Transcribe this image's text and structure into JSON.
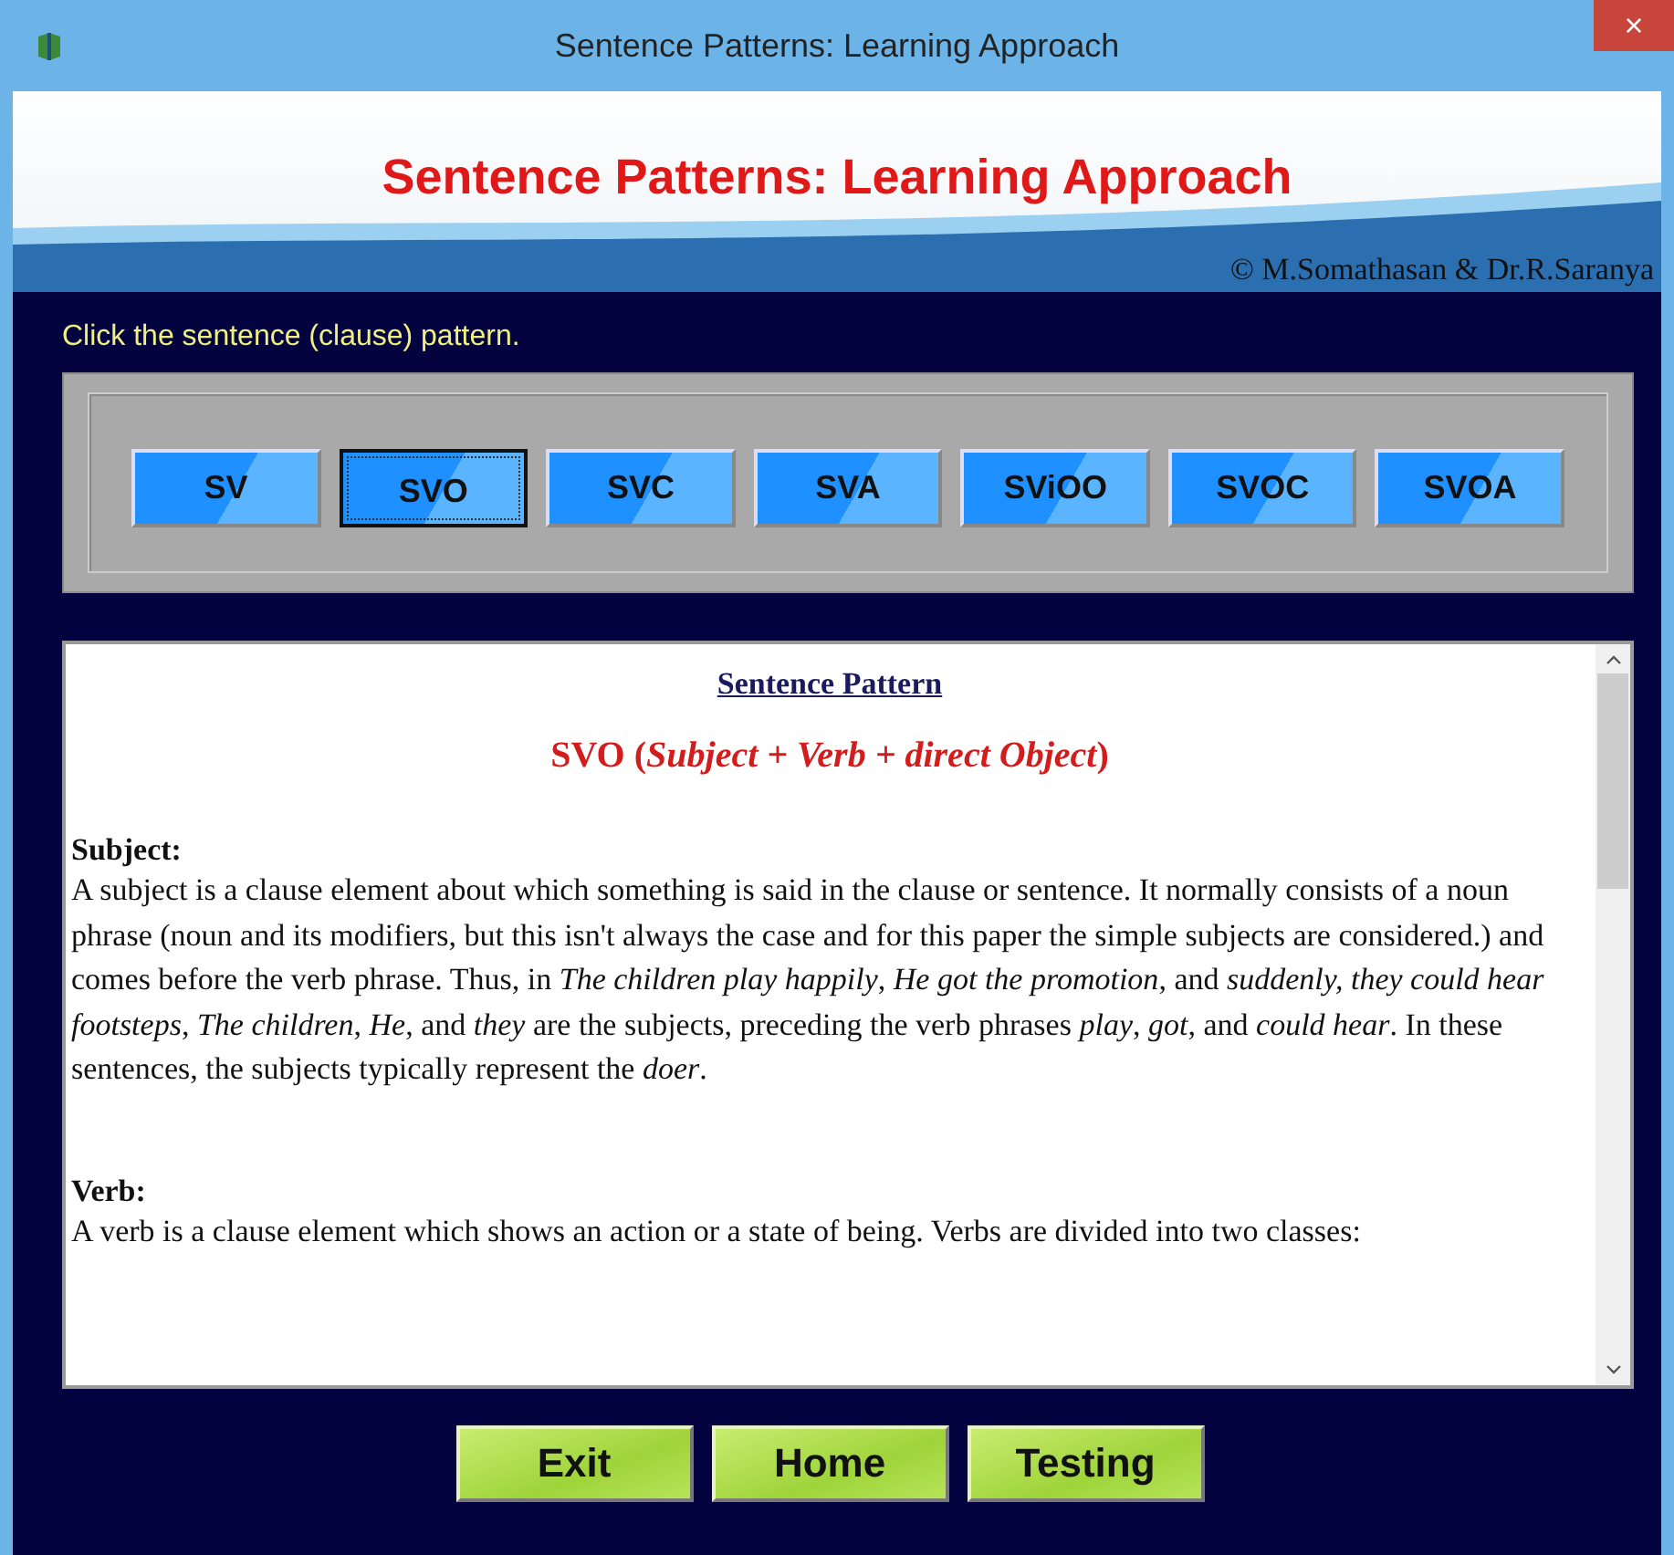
{
  "window": {
    "title": "Sentence Patterns: Learning Approach",
    "close": "×"
  },
  "header": {
    "title": "Sentence Patterns: Learning Approach",
    "credit": "© M.Somathasan & Dr.R.Saranya"
  },
  "instruction": "Click the sentence (clause) pattern.",
  "patterns": [
    {
      "label": "SV",
      "selected": false
    },
    {
      "label": "SVO",
      "selected": true
    },
    {
      "label": "SVC",
      "selected": false
    },
    {
      "label": "SVA",
      "selected": false
    },
    {
      "label": "SViOO",
      "selected": false
    },
    {
      "label": "SVOC",
      "selected": false
    },
    {
      "label": "SVOA",
      "selected": false
    }
  ],
  "content": {
    "heading": "Sentence Pattern",
    "pattern_title": "SVO (*Subject + Verb + direct Object*)",
    "sections": [
      {
        "term": "Subject:",
        "text": "A subject is a clause element about which something is said in the clause or sentence. It normally consists of a noun phrase (noun and its modifiers, but this isn't always the case and for this paper the simple subjects are considered.) and comes before the verb phrase. Thus, in *The children play happily*, *He got the promotion*, and *suddenly, they could hear footsteps*, *The children*, *He*, and *they* are the subjects, preceding the verb phrases *play*, *got*, and *could hear*. In these sentences, the subjects typically represent the *doer*."
      },
      {
        "term": "Verb:",
        "text": "A verb is a clause element which shows an action or a state of being. Verbs are divided into two classes:"
      }
    ]
  },
  "buttons": [
    "Exit",
    "Home",
    "Testing"
  ]
}
